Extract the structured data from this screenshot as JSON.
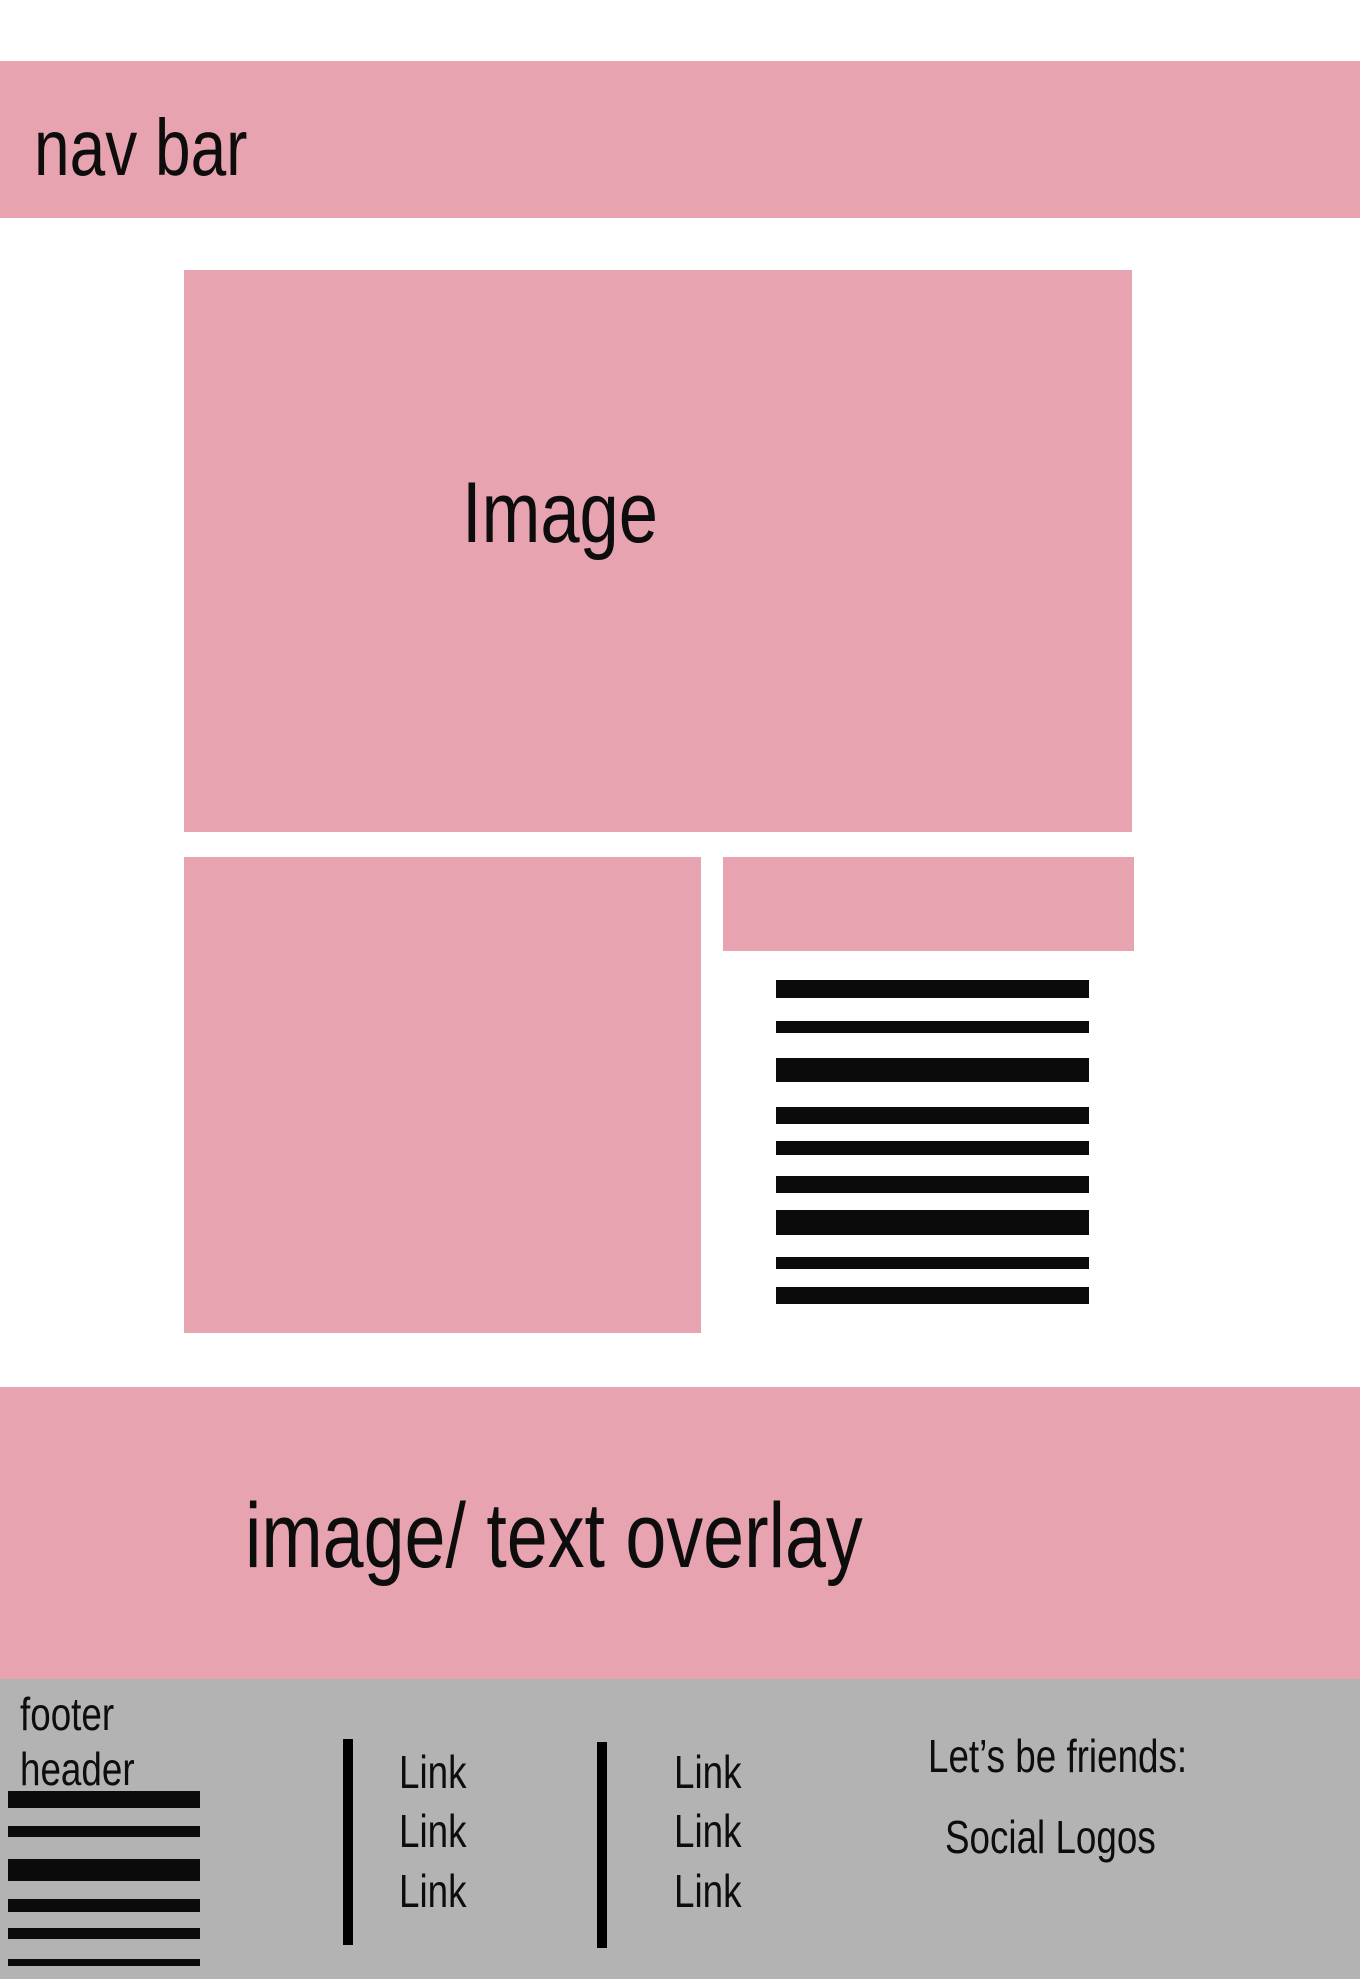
{
  "nav": {
    "label": "nav bar"
  },
  "hero": {
    "label": "Image"
  },
  "overlay": {
    "label": "image/ text overlay"
  },
  "footer": {
    "header_line1": "footer",
    "header_line2": "header",
    "links_col1": [
      "Link",
      "Link",
      "Link"
    ],
    "links_col2": [
      "Link",
      "Link",
      "Link"
    ],
    "social_heading": "Let’s be friends:",
    "social_logos": "Social Logos"
  },
  "colors": {
    "accent_pink": "#e8a3b0",
    "footer_gray": "#b3b3b3",
    "text": "#0d0d0d"
  }
}
